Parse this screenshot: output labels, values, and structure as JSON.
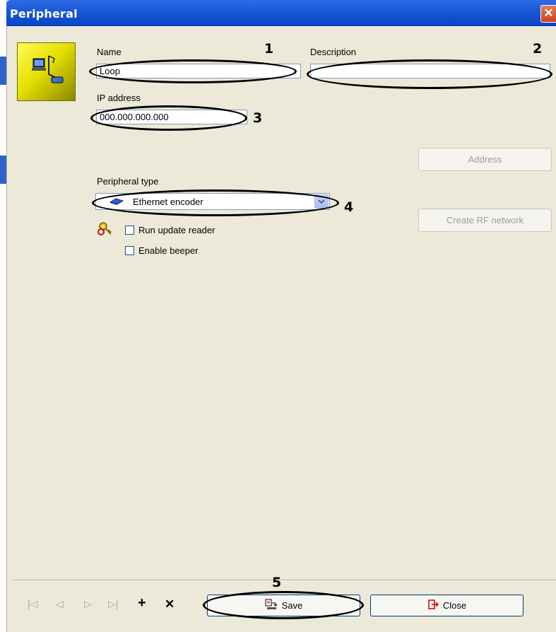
{
  "window": {
    "title": "Peripheral",
    "close_glyph": "✕"
  },
  "form": {
    "name_label": "Name",
    "name_value": "Loop",
    "description_label": "Description",
    "description_value": "",
    "ip_label": "IP address",
    "ip_value": "000.000.000.000",
    "peripheral_type_label": "Peripheral type",
    "peripheral_type_value": "Ethernet encoder",
    "run_update_reader_label": "Run update reader",
    "enable_beeper_label": "Enable beeper"
  },
  "buttons": {
    "address": "Address",
    "create_rf_network": "Create RF network",
    "save": "Save",
    "close": "Close"
  },
  "nav": {
    "first": "|◁",
    "prev": "◁",
    "next": "▷",
    "last": "▷|",
    "add": "+",
    "delete": "✕"
  },
  "annotations": [
    "1",
    "2",
    "3",
    "4",
    "5"
  ],
  "colors": {
    "titlebar": "#0a44c4",
    "accent_red": "#c8431f",
    "disabled_text": "#a19f90"
  }
}
